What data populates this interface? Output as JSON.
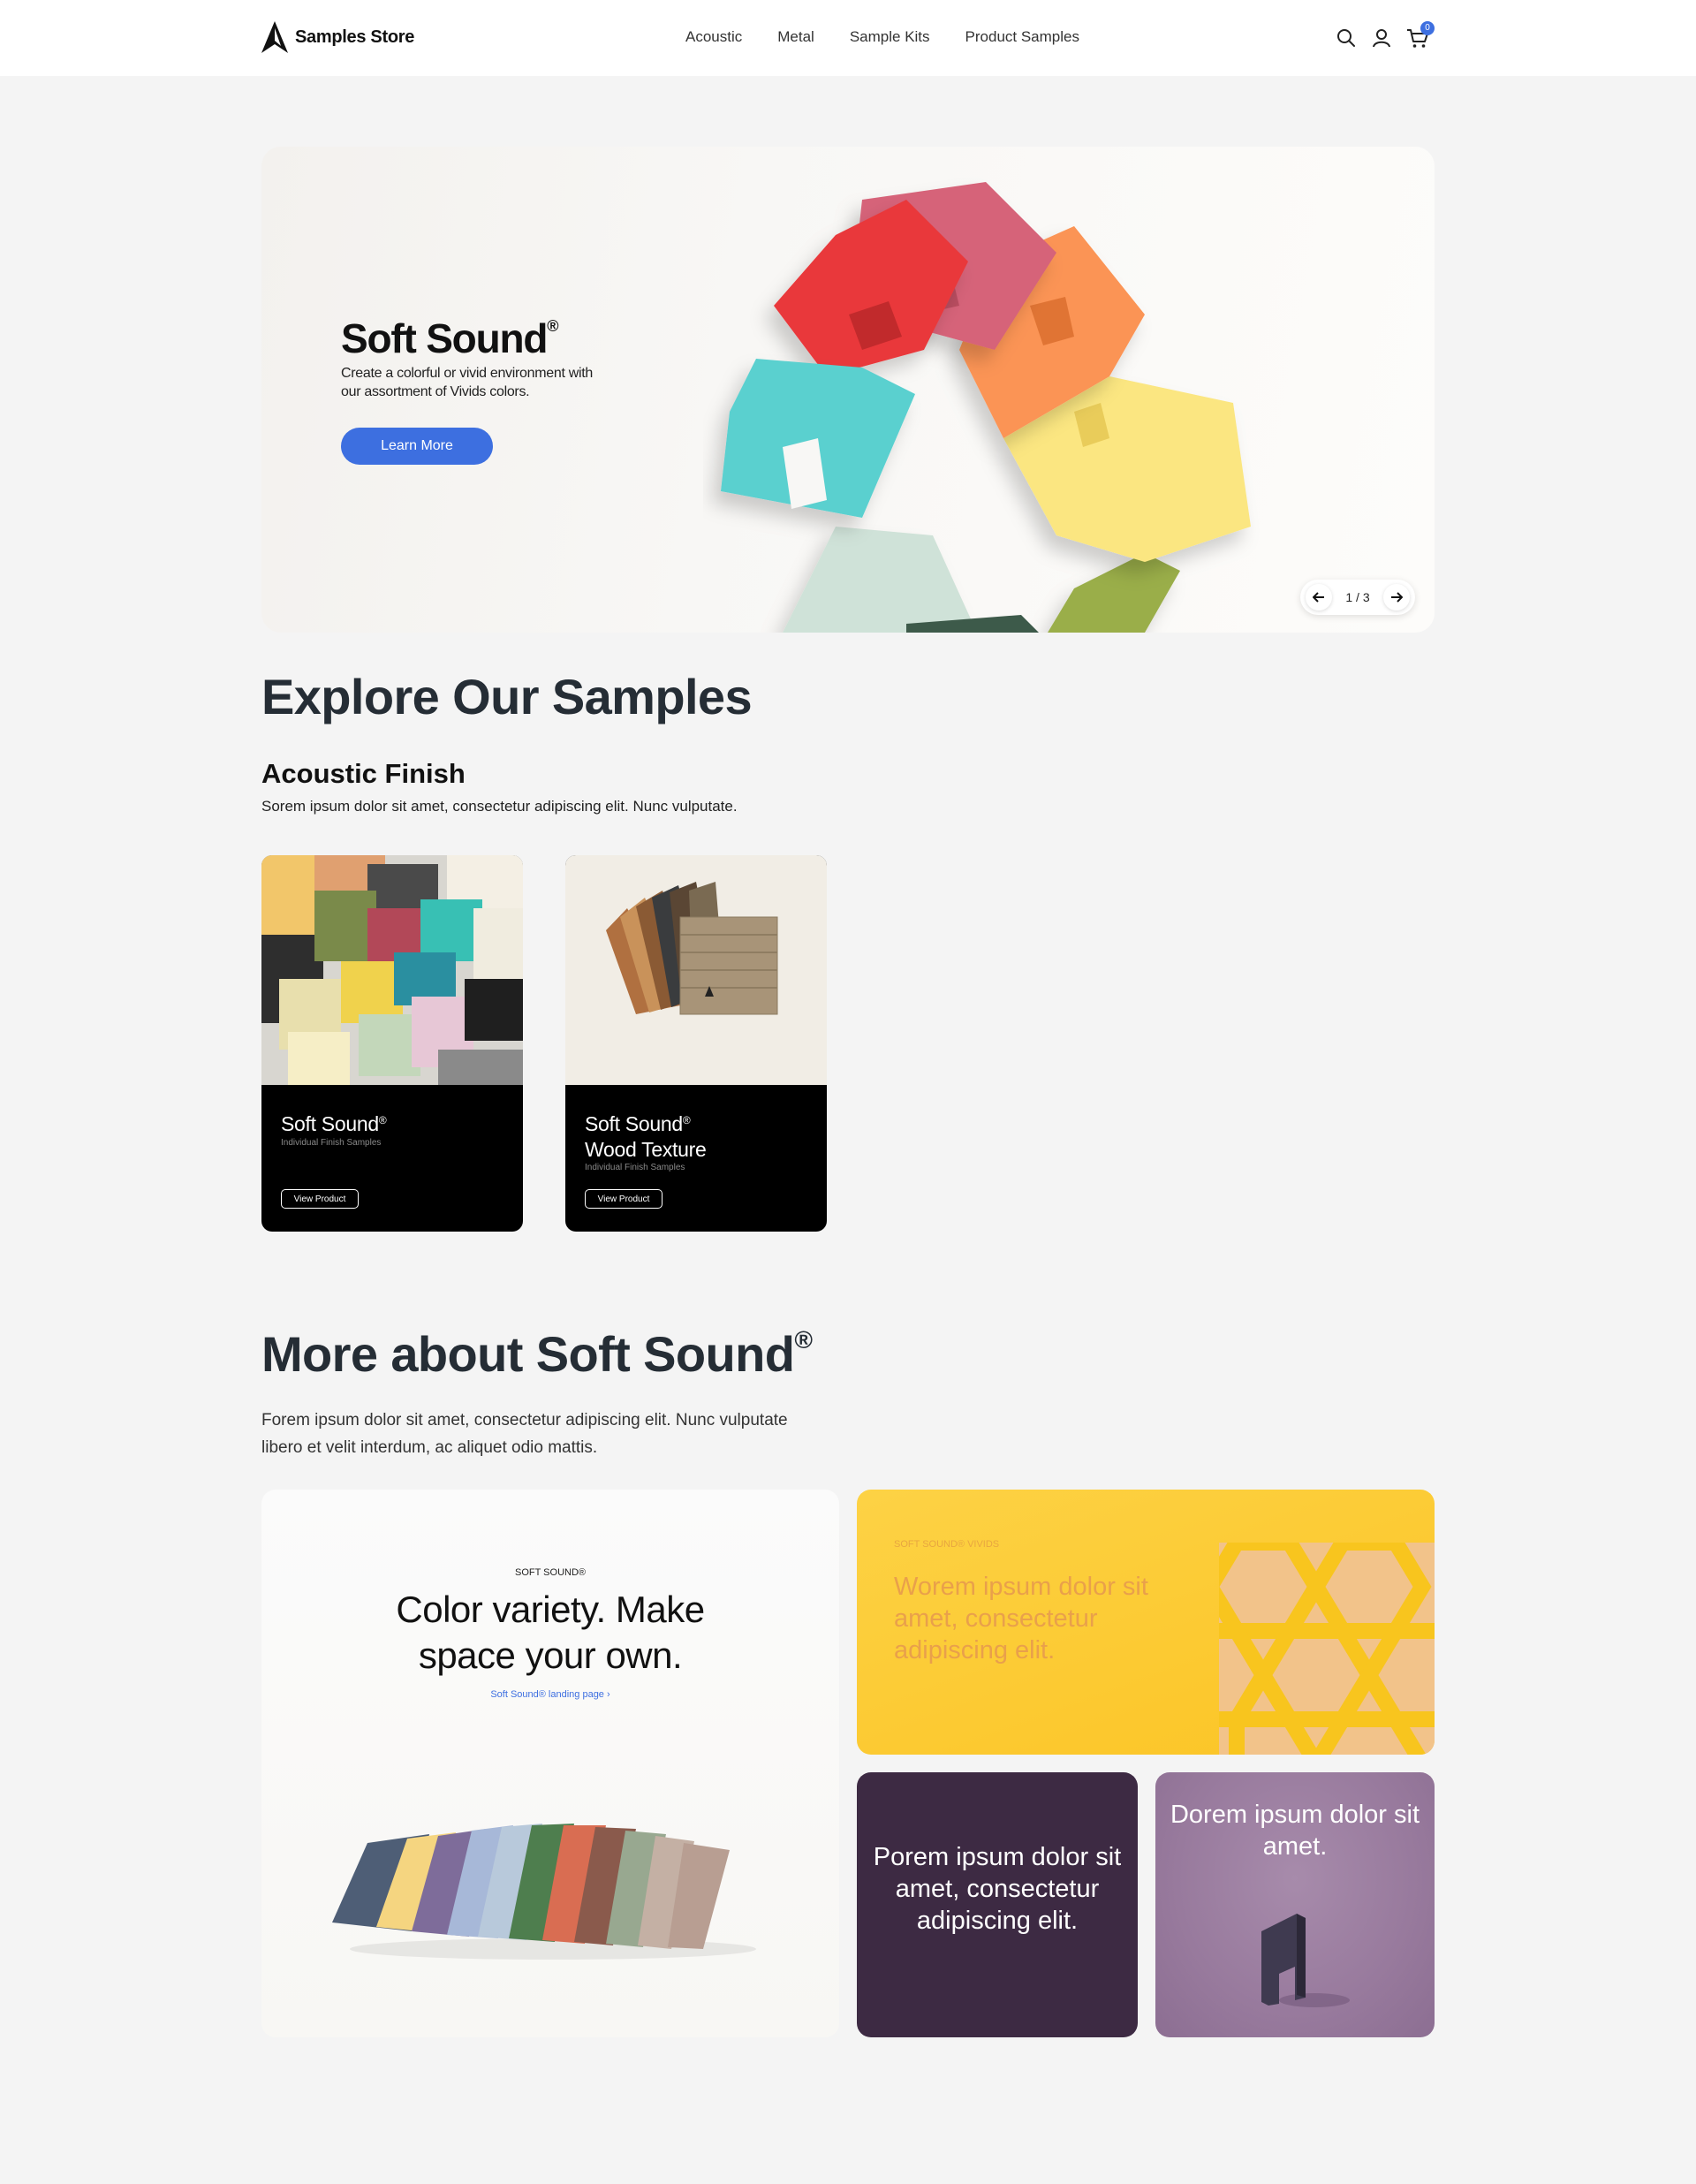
{
  "header": {
    "brand": "Samples Store",
    "nav": [
      "Acoustic",
      "Metal",
      "Sample Kits",
      "Product Samples"
    ],
    "cart_count": "0",
    "icons": [
      "search-icon",
      "account-icon",
      "cart-icon"
    ]
  },
  "hero": {
    "title": "Soft Sound",
    "title_mark": "®",
    "subtitle": "Create a colorful or vivid environment with our assortment of Vivids colors.",
    "button": "Learn More",
    "pager": "1 / 3"
  },
  "explore": {
    "title": "Explore Our Samples",
    "section_title": "Acoustic Finish",
    "section_desc": "Sorem ipsum dolor sit amet, consectetur adipiscing elit. Nunc vulputate.",
    "cards": [
      {
        "name_line1": "Soft Sound",
        "name_mark": "®",
        "name_line2": "",
        "tag": "Individual Finish Samples",
        "button": "View Product"
      },
      {
        "name_line1": "Soft Sound",
        "name_mark": "®",
        "name_line2": "Wood Texture",
        "tag": "Individual Finish Samples",
        "button": "View Product"
      }
    ]
  },
  "more": {
    "title": "More about Soft Sound",
    "title_mark": "®",
    "desc": "Forem ipsum dolor sit amet, consectetur adipiscing elit. Nunc vulputate libero et velit interdum, ac aliquet odio mattis.",
    "tile_main": {
      "kicker": "SOFT SOUND®",
      "headline_line1": "Color variety. Make",
      "headline_line2": "space your own.",
      "link": "Soft Sound® landing page"
    },
    "tile_yellow": {
      "kicker": "SOFT SOUND® VIVIDS",
      "headline": "Worem ipsum dolor sit amet, consectetur adipiscing elit."
    },
    "tile_dark": {
      "headline": "Porem ipsum dolor sit amet, consectetur adipiscing elit."
    },
    "tile_purple": {
      "headline": "Dorem ipsum dolor sit amet."
    }
  },
  "colors": {
    "accent": "#3d6fe0",
    "heading": "#252d35",
    "card_bg": "#000000",
    "yellow": "#fbc424",
    "plum": "#3d2a43"
  }
}
